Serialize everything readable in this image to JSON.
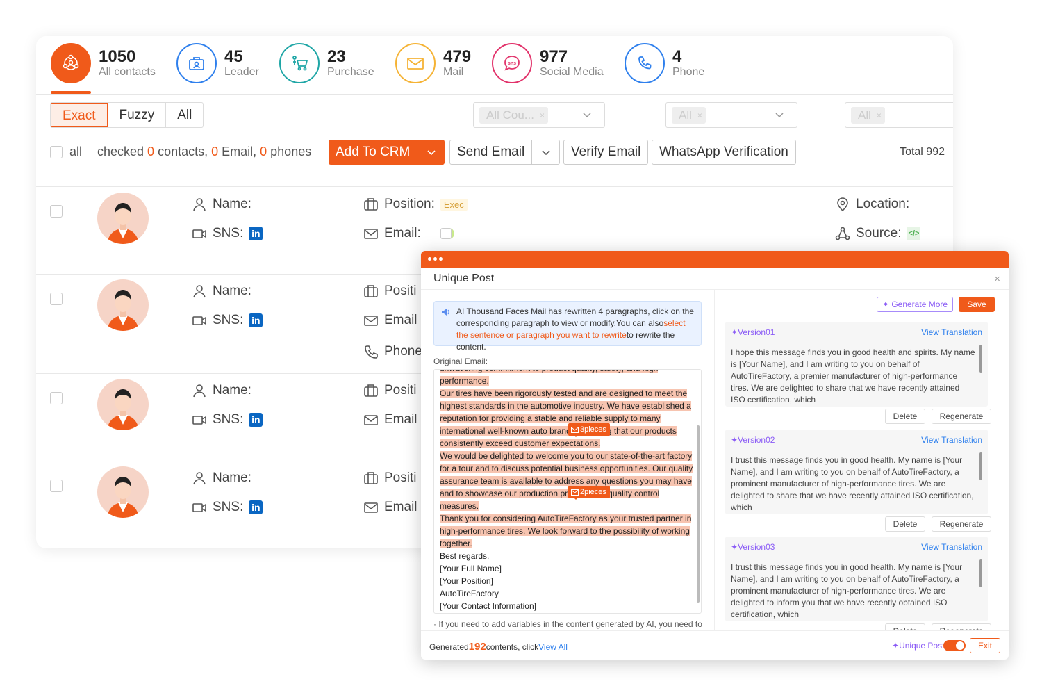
{
  "stats": [
    {
      "count": "1050",
      "label": "All contacts",
      "icon": "contacts-network-icon",
      "color": "#f05a1a",
      "active": true
    },
    {
      "count": "45",
      "label": "Leader",
      "icon": "briefcase-leader-icon",
      "color": "#2f80ed"
    },
    {
      "count": "23",
      "label": "Purchase",
      "icon": "shopping-cart-icon",
      "color": "#1fa6a6"
    },
    {
      "count": "479",
      "label": "Mail",
      "icon": "envelope-icon",
      "color": "#f5b335"
    },
    {
      "count": "977",
      "label": "Social Media",
      "icon": "sns-icon",
      "color": "#e2336b"
    },
    {
      "count": "4",
      "label": "Phone",
      "icon": "phone-icon",
      "color": "#2f80ed"
    }
  ],
  "match_modes": [
    "Exact",
    "Fuzzy",
    "All"
  ],
  "filters": [
    {
      "value": "All Cou..."
    },
    {
      "value": "All"
    },
    {
      "value": "All"
    }
  ],
  "toolbar": {
    "all_label": "all",
    "checked_prefix": "checked ",
    "contacts_count": "0",
    "contacts_suffix": " contacts, ",
    "email_count": "0",
    "email_suffix": " Email, ",
    "phones_count": "0",
    "phones_suffix": " phones",
    "add_to_crm": "Add To CRM",
    "send_email": "Send Email",
    "verify_email": "Verify Email",
    "whatsapp": "WhatsApp Verification",
    "total": "Total 992"
  },
  "labels": {
    "name": "Name:",
    "sns": "SNS:",
    "linkedin": "in",
    "position": "Position:",
    "position_cut": "Positi",
    "email": "Email:",
    "email_cut": "Email",
    "phone_cut": "Phone",
    "location": "Location:",
    "source": "Source:",
    "exec_tag": "Exec"
  },
  "modal": {
    "title": "Unique Post",
    "close": "×",
    "info_part1": "AI Thousand Faces Mail has rewritten 4 paragraphs, click on the corresponding paragraph to view or modify.You can also",
    "info_highlight": "select the sentence or paragraph you want to rewrite",
    "info_part2": "to rewrite the content.",
    "original_label": "Original Email:",
    "email_lines": [
      {
        "text": "unwavering commitment to product quality, safety, and high",
        "hl": true
      },
      {
        "text": "performance.",
        "hl": true
      },
      {
        "text": "Our tires have been rigorously tested and are designed to meet the",
        "hl": true
      },
      {
        "text": "highest standards in the automotive industry. We have established a",
        "hl": true
      },
      {
        "text": "reputation for providing a stable and reliable supply to many",
        "hl": true
      },
      {
        "text": "international well-known auto brands, ensuring that our products",
        "hl": true
      },
      {
        "text": "consistently exceed customer expectations.",
        "hl": true
      },
      {
        "text": "We would be delighted to welcome you to our state-of-the-art factory",
        "hl": true
      },
      {
        "text": "for a tour and to discuss potential business opportunities. Our quality",
        "hl": true
      },
      {
        "text": "assurance team is available to address any questions you may have",
        "hl": true
      },
      {
        "text": "and to showcase our production process and quality control",
        "hl": true
      },
      {
        "text": "measures.",
        "hl": true
      },
      {
        "text": "Thank you for considering AutoTireFactory as your trusted partner in",
        "hl": true
      },
      {
        "text": "high-performance tires. We look forward to the possibility of working",
        "hl": true
      },
      {
        "text": "together.",
        "hl": true
      },
      {
        "text": "Best regards,",
        "hl": false
      },
      {
        "text": "[Your Full Name]",
        "hl": false
      },
      {
        "text": "[Your Position]",
        "hl": false
      },
      {
        "text": "AutoTireFactory",
        "hl": false
      },
      {
        "text": "[Your Contact Information]",
        "hl": false
      }
    ],
    "pill1": "3pieces",
    "pill2": "2pieces",
    "note": "· If you need to add variables in the content generated by AI, you need to",
    "generate_more": "Generate More",
    "save": "Save",
    "versions": [
      {
        "title": "Version01",
        "translate": "View Translation",
        "body": "I hope this message finds you in good health and spirits. My name is [Your Name], and I am writing to you on behalf of AutoTireFactory, a premier manufacturer of high-performance tires. We are delighted to share that we have recently attained ISO certification, which",
        "delete": "Delete",
        "regenerate": "Regenerate"
      },
      {
        "title": "Version02",
        "translate": "View Translation",
        "body": "I trust this message finds you in good health. My name is [Your Name], and I am writing to you on behalf of AutoTireFactory, a prominent manufacturer of high-performance tires. We are delighted to share that we have recently attained ISO certification, which",
        "delete": "Delete",
        "regenerate": "Regenerate"
      },
      {
        "title": "Version03",
        "translate": "View Translation",
        "body": "I trust this message finds you in good health. My name is [Your Name], and I am writing to you on behalf of AutoTireFactory, a prominent manufacturer of high-performance tires. We are delighted to inform you that we have recently obtained ISO certification, which",
        "delete": "Delete",
        "regenerate": "Regenerate"
      }
    ],
    "footer_prefix": "Generated",
    "footer_count": "192",
    "footer_mid": "contents, click",
    "footer_link": "View All",
    "unique_toggle_label": "Unique Post",
    "exit": "Exit"
  }
}
